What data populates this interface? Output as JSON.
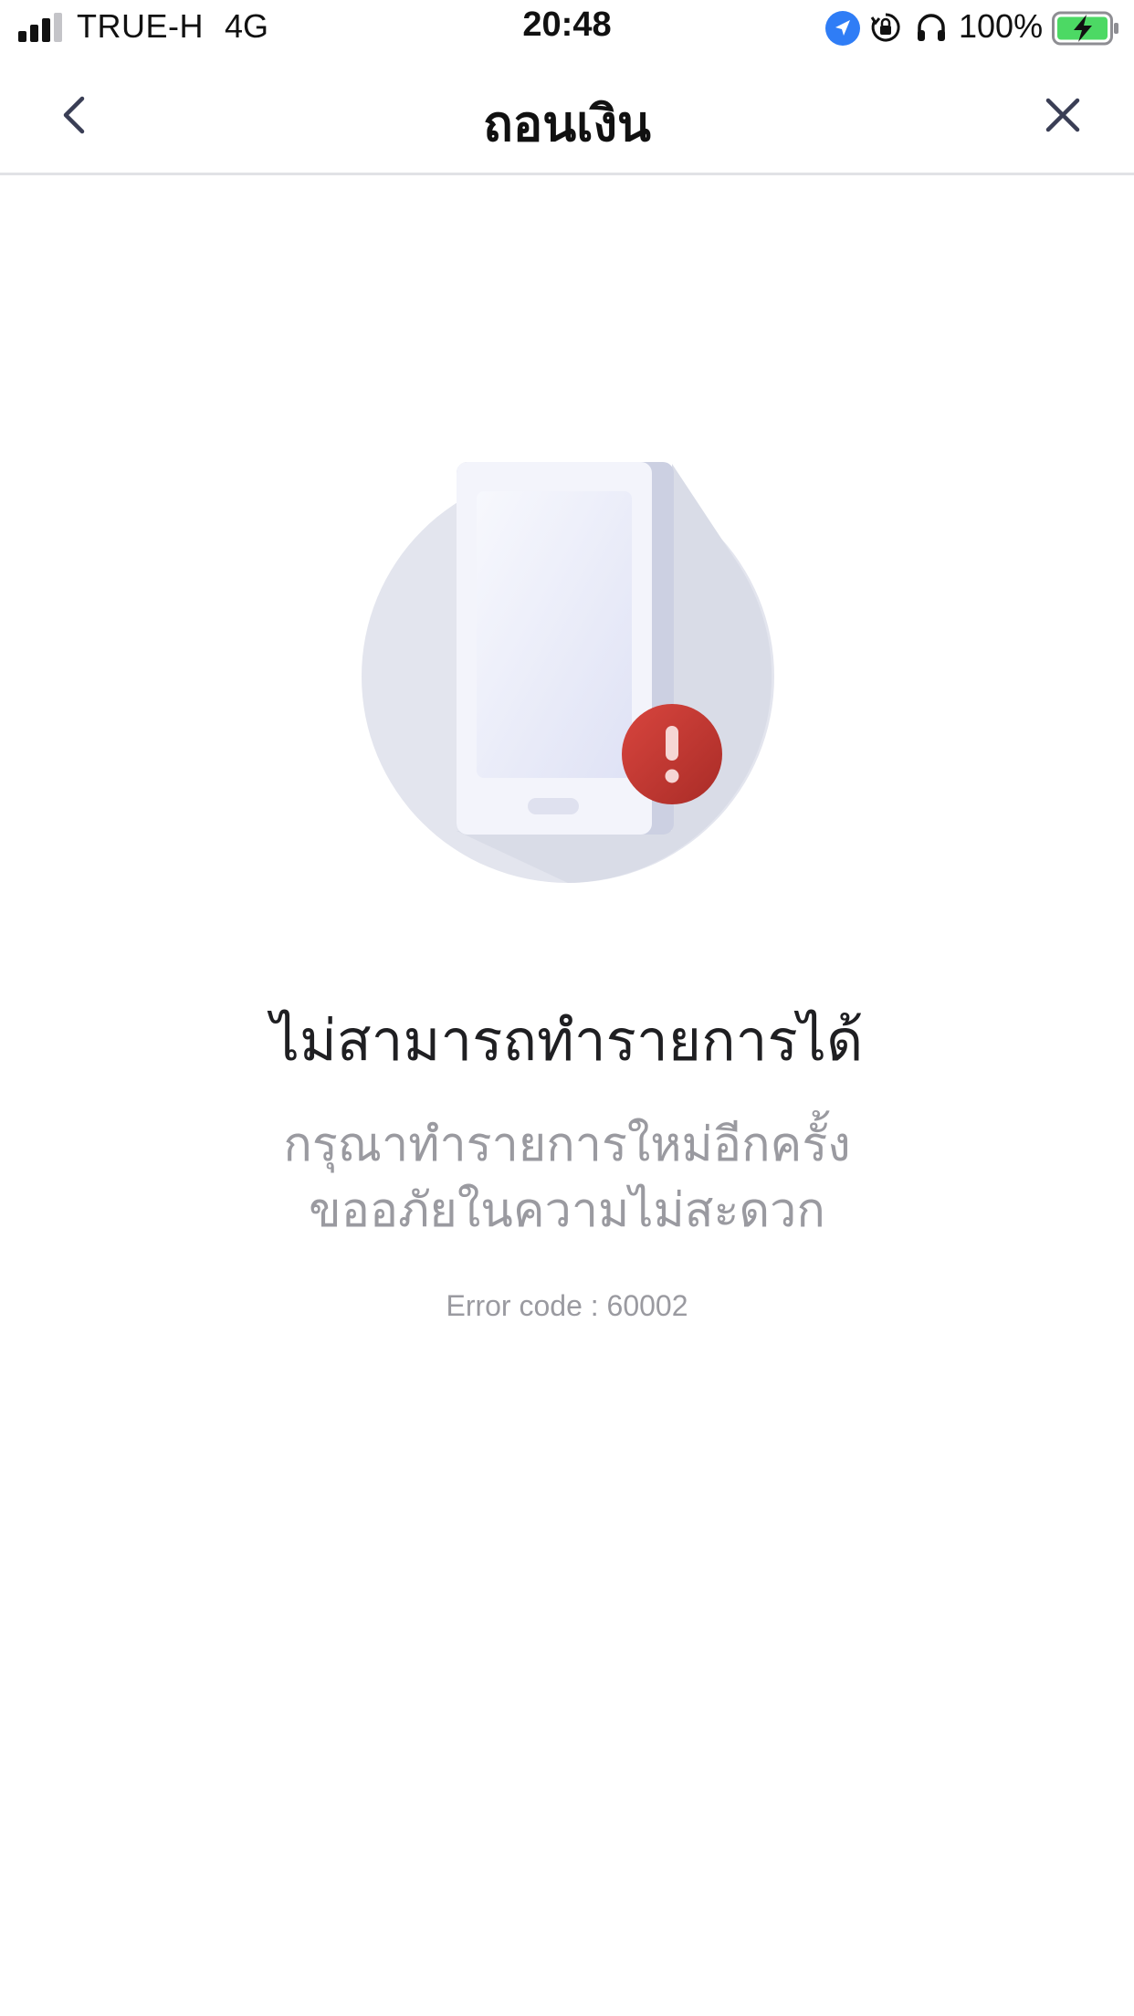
{
  "status_bar": {
    "carrier": "TRUE-H",
    "network": "4G",
    "time": "20:48",
    "battery_percent": "100%",
    "icons": [
      "signal-icon",
      "location-icon",
      "orientation-lock-icon",
      "headphones-icon",
      "battery-charging-icon"
    ]
  },
  "nav": {
    "title": "ถอนเงิน",
    "back_icon": "chevron-left-icon",
    "close_icon": "close-icon"
  },
  "illustration": {
    "icon": "phone-error-icon",
    "badge_icon": "exclamation-icon"
  },
  "error": {
    "title": "ไม่สามารถทำรายการได้",
    "message_line1": "กรุณาทำรายการใหม่อีกครั้ง",
    "message_line2": "ขออภัยในความไม่สะดวก",
    "code": "Error code : 60002"
  },
  "colors": {
    "error_badge": "#c8362f",
    "circle_bg": "#e3e5ee",
    "location_blue": "#2f7df6",
    "battery_green": "#4cd964",
    "divider": "#e1e2e6",
    "secondary_text": "#9a9aa0"
  }
}
